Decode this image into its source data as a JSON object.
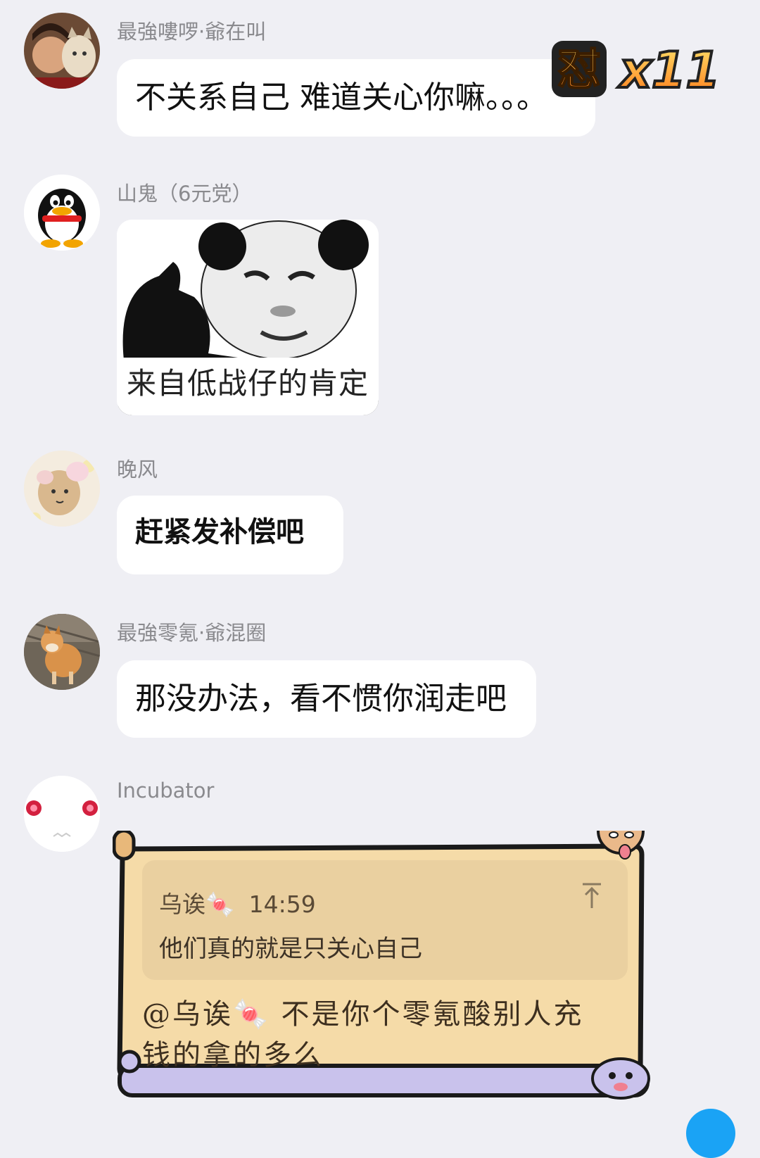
{
  "messages": [
    {
      "sender": "最強嘍啰·爺在叫",
      "text": "不关系自己 难道关心你嘛。。。",
      "avatar": "photo-with-cat-avatar"
    },
    {
      "sender": "山鬼（6元党）",
      "sticker_caption": "来自低战仔的肯定",
      "avatar": "qq-penguin-avatar"
    },
    {
      "sender": "晚风",
      "text": "赶紧发补偿吧",
      "avatar": "sheep-cartoon-avatar"
    },
    {
      "sender": "最強零氪·爺混圈",
      "text": "那没办法，看不惯你润走吧",
      "avatar": "shiba-dog-avatar"
    },
    {
      "sender": "Incubator",
      "avatar": "kyubey-avatar",
      "quote": {
        "author": "乌诶🍬",
        "time": "14:59",
        "text": "他们真的就是只关心自己"
      },
      "text_line1": "@乌诶🍬 不是你个零氪酸别人充",
      "text_line2": "钱的拿的多么"
    }
  ],
  "badge": {
    "label": "怼",
    "count": "x11"
  },
  "colors": {
    "background": "#efeff4",
    "bubble": "#ffffff",
    "scroll": "#f5dba8",
    "accent": "#1aa3f5"
  }
}
